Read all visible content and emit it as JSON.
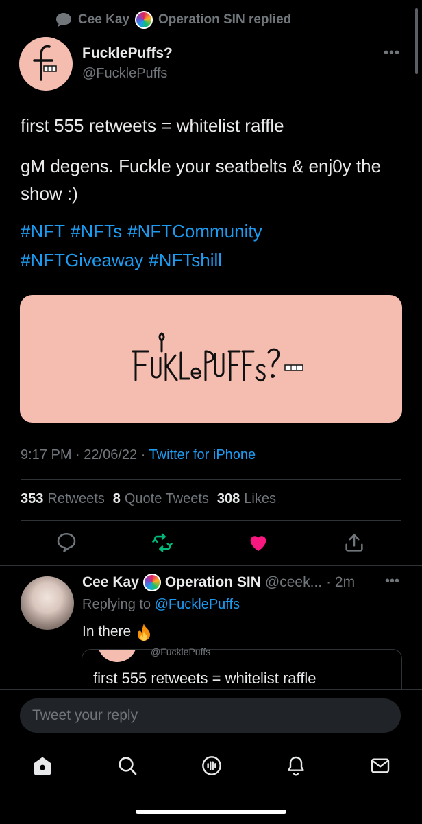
{
  "context": {
    "name": "Cee Kay",
    "text": "Operation SIN replied"
  },
  "author": {
    "name": "FucklePuffs?",
    "handle": "@FucklePuffs",
    "avatar_letter": "f"
  },
  "tweet": {
    "line1": "first 555 retweets = whitelist raffle",
    "line2": "gM degens. Fuckle your seatbelts & enj0y the show :)",
    "hashtags": [
      "#NFT",
      "#NFTs",
      "#NFTCommunity",
      "#NFTGiveaway",
      "#NFTshill"
    ],
    "media_logo_text": "FUKLePUFFs?"
  },
  "meta": {
    "time": "9:17 PM",
    "date": "22/06/22",
    "source": "Twitter for iPhone"
  },
  "stats": {
    "retweets_count": "353",
    "retweets_label": "Retweets",
    "quotes_count": "8",
    "quotes_label": "Quote Tweets",
    "likes_count": "308",
    "likes_label": "Likes"
  },
  "reply": {
    "name": "Cee Kay",
    "name2": "Operation SIN",
    "handle": "@ceek...",
    "time": "· 2m",
    "replying_prefix": "Replying to",
    "replying_to": "@FucklePuffs",
    "text": "In there",
    "quote_handle": "@FucklePuffs",
    "quote_text": "first 555 retweets = whitelist raffle"
  },
  "reply_box": {
    "placeholder": "Tweet your reply"
  },
  "colors": {
    "accent": "#1d9bf0",
    "like": "#f91880",
    "retweet": "#00ba7c",
    "brand_pink": "#f4bdb0"
  },
  "icons": {
    "context": "speech-bubble-icon",
    "nav": [
      "home-icon",
      "search-icon",
      "spaces-icon",
      "notifications-icon",
      "messages-icon"
    ]
  }
}
